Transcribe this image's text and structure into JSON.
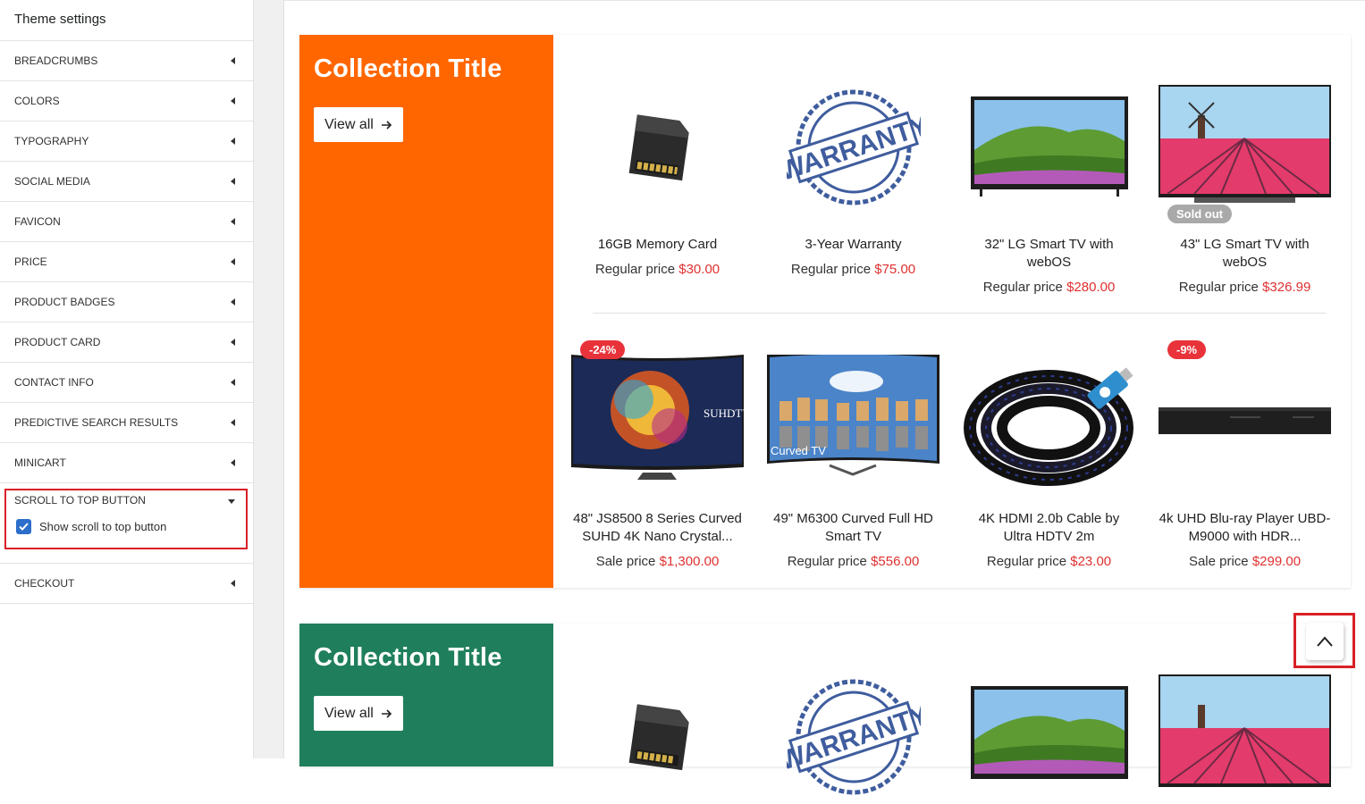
{
  "sidebar": {
    "title": "Theme settings",
    "items_top": [
      {
        "label": "BREADCRUMBS"
      },
      {
        "label": "COLORS"
      },
      {
        "label": "TYPOGRAPHY"
      },
      {
        "label": "SOCIAL MEDIA"
      },
      {
        "label": "FAVICON"
      },
      {
        "label": "PRICE"
      },
      {
        "label": "PRODUCT BADGES"
      },
      {
        "label": "PRODUCT CARD"
      },
      {
        "label": "CONTACT INFO"
      },
      {
        "label": "PREDICTIVE SEARCH RESULTS"
      },
      {
        "label": "MINICART"
      }
    ],
    "open_section": {
      "label": "SCROLL TO TOP BUTTON",
      "checkbox_label": "Show scroll to top button",
      "checked": true
    },
    "items_bottom": [
      {
        "label": "CHECKOUT"
      }
    ]
  },
  "collections": [
    {
      "title": "Collection Title",
      "view_all": "View all",
      "color": "#ff6600",
      "products": [
        {
          "name": "16GB Memory Card",
          "price_label": "Regular price",
          "price": "$30.00",
          "image": "memory-card"
        },
        {
          "name": "3-Year Warranty",
          "price_label": "Regular price",
          "price": "$75.00",
          "image": "warranty-stamp"
        },
        {
          "name": "32\" LG Smart TV with webOS",
          "price_label": "Regular price",
          "price": "$280.00",
          "image": "tv-hills"
        },
        {
          "name": "43\" LG Smart TV with webOS",
          "price_label": "Regular price",
          "price": "$326.99",
          "image": "tv-tulips",
          "badge": "Sold out"
        },
        {
          "name": "48\" JS8500 8 Series Curved SUHD 4K Nano Crystal...",
          "price_label": "Sale price",
          "price": "$1,300.00",
          "image": "tv-suhd",
          "badge": "-24%"
        },
        {
          "name": "49\" M6300 Curved Full HD Smart TV",
          "price_label": "Regular price",
          "price": "$556.00",
          "image": "tv-curved"
        },
        {
          "name": "4K HDMI 2.0b Cable by Ultra HDTV 2m",
          "price_label": "Regular price",
          "price": "$23.00",
          "image": "hdmi-cable"
        },
        {
          "name": "4k UHD Blu-ray Player UBD-M9000 with HDR...",
          "price_label": "Sale price",
          "price": "$299.00",
          "image": "bluray-player",
          "badge": "-9%"
        }
      ]
    },
    {
      "title": "Collection Title",
      "view_all": "View all",
      "color": "#1f7f5c"
    }
  ],
  "scroll_top": {
    "icon": "chevron-up-icon"
  }
}
